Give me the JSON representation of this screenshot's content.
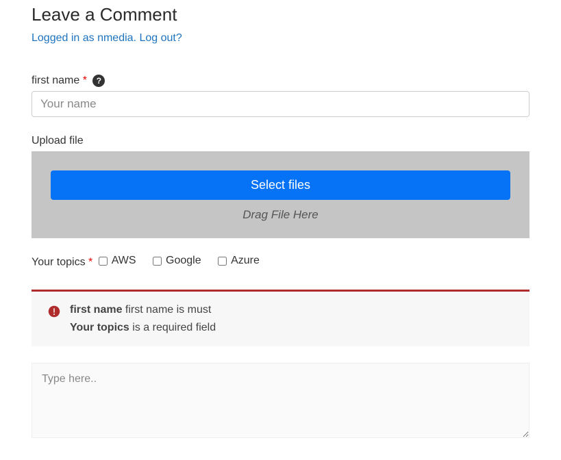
{
  "heading": "Leave a Comment",
  "auth": {
    "prefix": "Logged in as ",
    "username": "nmedia",
    "separator": ". ",
    "logout_text": "Log out?"
  },
  "first_name": {
    "label": "first name",
    "required_mark": "*",
    "placeholder": "Your name",
    "value": ""
  },
  "upload": {
    "label": "Upload file",
    "button_label": "Select files",
    "drag_caption": "Drag File Here"
  },
  "topics": {
    "label": "Your topics",
    "required_mark": "*",
    "options": [
      "AWS",
      "Google",
      "Azure"
    ]
  },
  "validation": {
    "messages": [
      {
        "field": "first name",
        "text": "first name is must"
      },
      {
        "field": "Your topics",
        "text": "is a required field"
      }
    ]
  },
  "comment": {
    "placeholder": "Type here..",
    "value": ""
  }
}
